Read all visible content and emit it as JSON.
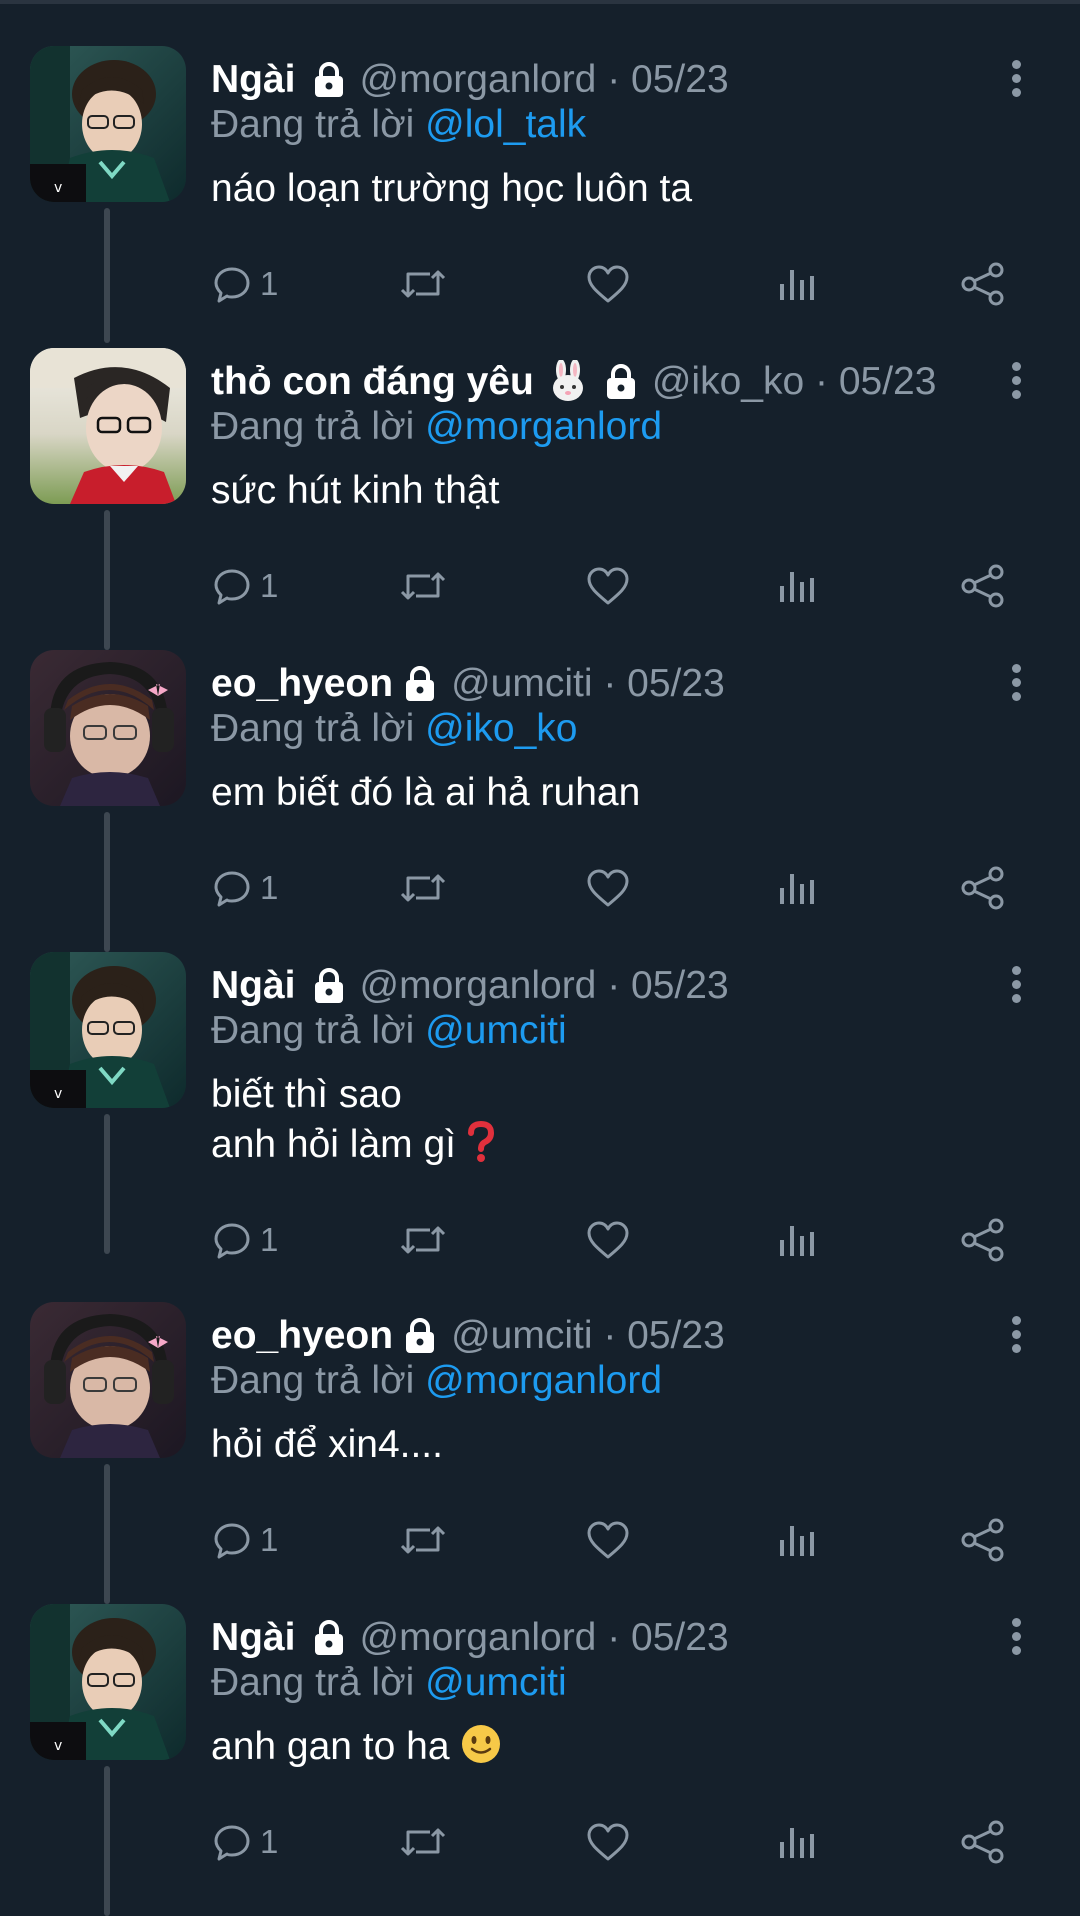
{
  "colors": {
    "background": "#15202b",
    "muted": "#8b98a5",
    "accent_link": "#1d9bf0",
    "thread_line": "#3d4751"
  },
  "icons": {
    "protected": "lock-icon",
    "reply": "reply-icon",
    "retweet": "retweet-icon",
    "like": "heart-icon",
    "views": "analytics-icon",
    "share": "share-icon",
    "more": "more-vertical-icon"
  },
  "tweets": [
    {
      "name": "Ngài",
      "handle": "@morganlord",
      "date": "05/23",
      "replying_prefix": "Đang trả lời",
      "replying_to": "@lol_talk",
      "lines": [
        "náo loạn trường học luôn ta"
      ],
      "reply_count": "1"
    },
    {
      "name": "thỏ con đáng yêu",
      "name_emoji": "rabbit-face",
      "handle": "@iko_ko",
      "date": "05/23",
      "replying_prefix": "Đang trả lời",
      "replying_to": "@morganlord",
      "lines": [
        "sức hút kinh thật"
      ],
      "reply_count": "1"
    },
    {
      "name": "eo_hyeon",
      "handle": "@umciti",
      "date": "05/23",
      "replying_prefix": "Đang trả lời",
      "replying_to": "@iko_ko",
      "lines": [
        "em biết đó là ai hả ruhan"
      ],
      "reply_count": "1"
    },
    {
      "name": "Ngài",
      "handle": "@morganlord",
      "date": "05/23",
      "replying_prefix": "Đang trả lời",
      "replying_to": "@umciti",
      "lines": [
        "biết thì sao",
        "anh hỏi làm gì"
      ],
      "line_emoji": "red-question-mark",
      "reply_count": "1"
    },
    {
      "name": "eo_hyeon",
      "handle": "@umciti",
      "date": "05/23",
      "replying_prefix": "Đang trả lời",
      "replying_to": "@morganlord",
      "lines": [
        "hỏi để xin4...."
      ],
      "reply_count": "1"
    },
    {
      "name": "Ngài",
      "handle": "@morganlord",
      "date": "05/23",
      "replying_prefix": "Đang trả lời",
      "replying_to": "@umciti",
      "lines": [
        "anh gan to ha"
      ],
      "line_emoji": "slightly-smiling-face",
      "reply_count": "1"
    }
  ]
}
